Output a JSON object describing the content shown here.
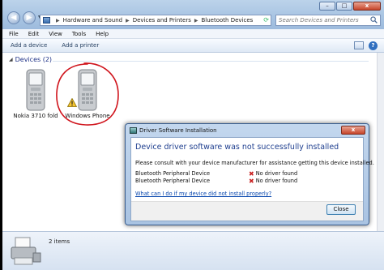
{
  "window": {
    "breadcrumbs": [
      "Hardware and Sound",
      "Devices and Printers",
      "Bluetooth Devices"
    ],
    "search_placeholder": "Search Devices and Printers",
    "caption": {
      "minimize": "–",
      "maximize": "□",
      "close": "x"
    }
  },
  "menu": {
    "file": "File",
    "edit": "Edit",
    "view": "View",
    "tools": "Tools",
    "help": "Help"
  },
  "commands": {
    "add_device": "Add a device",
    "add_printer": "Add a printer",
    "help_glyph": "?"
  },
  "devices_group": {
    "header": "Devices (2)",
    "items": [
      {
        "label": "Nokia 3710 fold",
        "icon": "phone-icon",
        "warning": false
      },
      {
        "label": "Windows Phone",
        "icon": "phone-icon",
        "warning": true
      }
    ]
  },
  "details_pane": {
    "count": "2 items",
    "icon": "printer-icon"
  },
  "dialog": {
    "title": "Driver Software Installation",
    "close_glyph": "x",
    "heading": "Device driver software was not successfully installed",
    "message": "Please consult with your device manufacturer for assistance getting this device installed.",
    "rows": [
      {
        "device": "Bluetooth Peripheral Device",
        "status": "No driver found"
      },
      {
        "device": "Bluetooth Peripheral Device",
        "status": "No driver found"
      }
    ],
    "help_link": "What can I do if my device did not install properly?",
    "close_button": "Close"
  },
  "colors": {
    "annotation": "#d0141c",
    "heading": "#1f3f8f",
    "link": "#0645ad",
    "error": "#c81e1e"
  }
}
